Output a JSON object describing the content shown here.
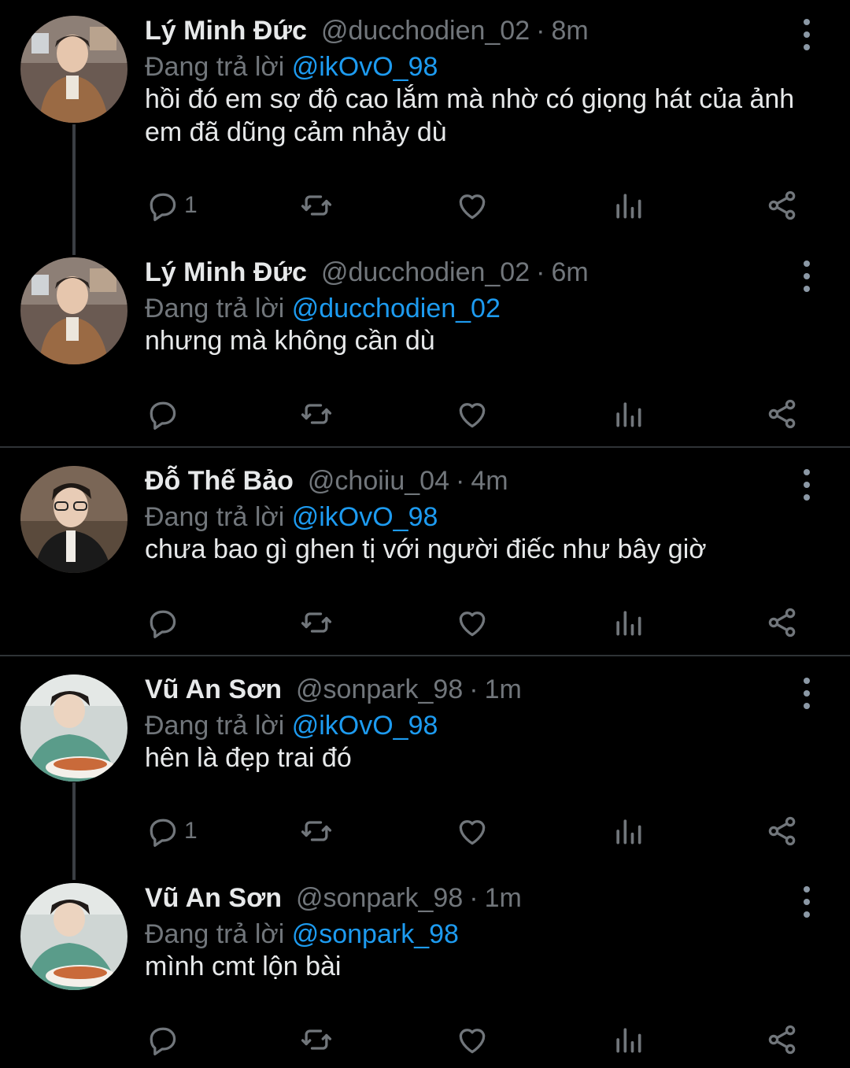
{
  "colors": {
    "background": "#000000",
    "name_text": "#e7e9ea",
    "secondary_text": "#71767b",
    "mention": "#1d9bf0",
    "divider": "#2f3336",
    "thread_line": "#3b3f44"
  },
  "tweets": [
    {
      "name": "Lý Minh Đức",
      "handle": "@ducchodien_02",
      "separator": "·",
      "time": "8m",
      "reply_prefix": "Đang trả lời",
      "reply_to": "@ikOvO_98",
      "text": "hồi đó em sợ độ cao lắm mà nhờ có giọng hát của ảnh em đã dũng cảm nhảy dù",
      "reply_count": "1",
      "avatar_icon": "avatar-photo-brown-jacket"
    },
    {
      "name": "Lý Minh Đức",
      "handle": "@ducchodien_02",
      "separator": "·",
      "time": "6m",
      "reply_prefix": "Đang trả lời",
      "reply_to": "@ducchodien_02",
      "text": "nhưng mà không cần dù",
      "reply_count": "",
      "avatar_icon": "avatar-photo-brown-jacket"
    },
    {
      "name": "Đỗ Thế Bảo",
      "handle": "@choiiu_04",
      "separator": "·",
      "time": "4m",
      "reply_prefix": "Đang trả lời",
      "reply_to": "@ikOvO_98",
      "text": "chưa bao gì ghen tị với người điếc như bây giờ",
      "reply_count": "",
      "avatar_icon": "avatar-photo-glasses"
    },
    {
      "name": "Vũ An Sơn",
      "handle": "@sonpark_98",
      "separator": "·",
      "time": "1m",
      "reply_prefix": "Đang trả lời",
      "reply_to": "@ikOvO_98",
      "text": "hên là đẹp trai đó",
      "reply_count": "1",
      "avatar_icon": "avatar-photo-eating"
    },
    {
      "name": "Vũ An Sơn",
      "handle": "@sonpark_98",
      "separator": "·",
      "time": "1m",
      "reply_prefix": "Đang trả lời",
      "reply_to": "@sonpark_98",
      "text": "mình cmt lộn bài",
      "reply_count": "",
      "avatar_icon": "avatar-photo-eating"
    }
  ],
  "action_icons": [
    "reply-icon",
    "retweet-icon",
    "like-icon",
    "views-icon",
    "share-icon"
  ],
  "more_icon": "more-options-icon"
}
